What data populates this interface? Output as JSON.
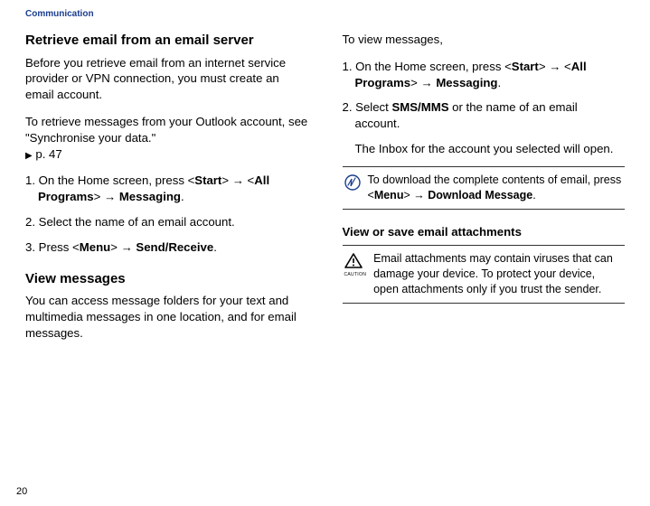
{
  "breadcrumb": "Communication",
  "page_number": "20",
  "left": {
    "h1": "Retrieve email from an email server",
    "intro": "Before you retrieve email from an internet service provider or VPN connection, you must create an email account.",
    "outlook_a": "To retrieve messages from your Outlook account, see \"Synchronise your data.\"",
    "outlook_b": " p. 47",
    "s1_a": "1. On the Home screen, press <",
    "s1_b": "Start",
    "s1_c": "> ",
    "s1_d": " <",
    "s1_e": "All Programs",
    "s1_f": "> ",
    "s1_g": " ",
    "s1_h": "Messaging",
    "s1_i": ".",
    "s2": "2. Select the name of an email account.",
    "s3_a": "3. Press <",
    "s3_b": "Menu",
    "s3_c": "> ",
    "s3_d": " ",
    "s3_e": "Send/Receive",
    "s3_f": ".",
    "h2": "View messages",
    "view_para": "You can access message folders for your text and multimedia messages in one location, and for email messages."
  },
  "right": {
    "lead": "To view messages,",
    "s1_a": "1. On the Home screen, press <",
    "s1_b": "Start",
    "s1_c": "> ",
    "s1_d": " <",
    "s1_e": "All Programs",
    "s1_f": "> ",
    "s1_g": " ",
    "s1_h": "Messaging",
    "s1_i": ".",
    "s2_a": "2. Select ",
    "s2_b": "SMS/MMS",
    "s2_c": " or the name of an email account.",
    "s2_sub": "The Inbox for the account you selected will open.",
    "note1_a": "To download the complete contents of email, press <",
    "note1_b": "Menu",
    "note1_c": "> ",
    "note1_d": " ",
    "note1_e": "Download Message",
    "note1_f": ".",
    "h3": "View or save email attachments",
    "caution": "Email attachments may contain viruses that can damage your device. To protect your device, open attachments only if you trust the sender.",
    "caution_label": "CAUTION"
  }
}
